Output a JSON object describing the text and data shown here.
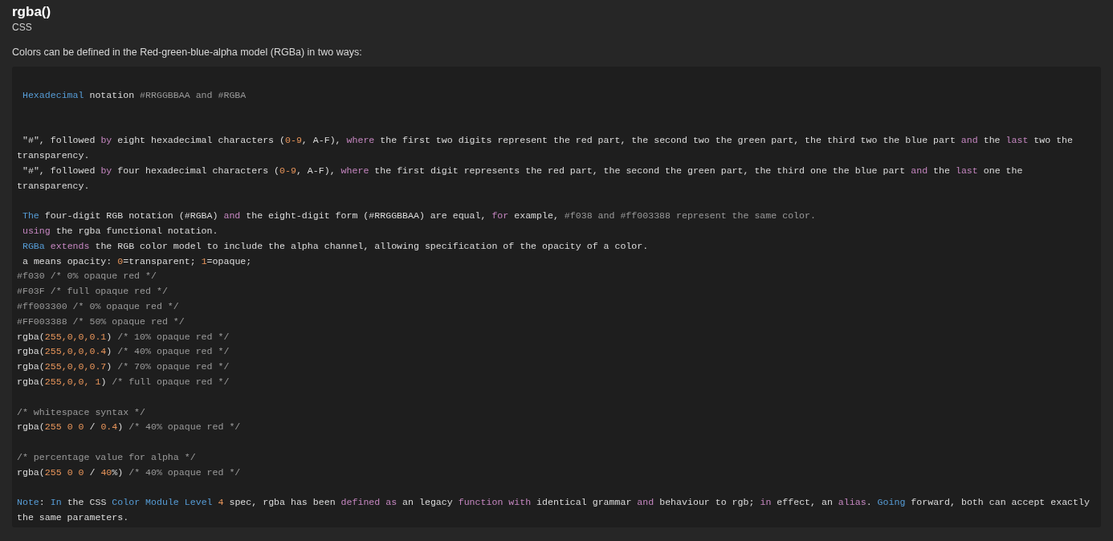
{
  "title": "rgba()",
  "subtitle": "CSS",
  "intro": "Colors can be defined in the Red-green-blue-alpha model (RGBa) in two ways:",
  "code_lines": [
    {
      "kind": "blank"
    },
    {
      "kind": "code",
      "indent": true,
      "tokens": [
        {
          "kind": "type",
          "s": "Hexadecimal"
        },
        {
          "kind": "plain",
          "s": " notation "
        },
        {
          "kind": "comment",
          "s": "#RRGGBBAA and #RGBA"
        }
      ]
    },
    {
      "kind": "blank"
    },
    {
      "kind": "blank"
    },
    {
      "kind": "code",
      "tokens": [
        {
          "kind": "plain",
          "s": " \"#\", followed "
        },
        {
          "kind": "keyword",
          "s": "by"
        },
        {
          "kind": "plain",
          "s": " eight hexadecimal characters ("
        },
        {
          "kind": "number",
          "s": "0-9"
        },
        {
          "kind": "plain",
          "s": ", A-F), "
        },
        {
          "kind": "keyword",
          "s": "where"
        },
        {
          "kind": "plain",
          "s": " the first two digits represent the red part, the second two the green part, the third two the blue part "
        },
        {
          "kind": "keyword",
          "s": "and"
        },
        {
          "kind": "plain",
          "s": " the "
        },
        {
          "kind": "keyword",
          "s": "last"
        },
        {
          "kind": "plain",
          "s": " two the transparency."
        }
      ]
    },
    {
      "kind": "code",
      "tokens": [
        {
          "kind": "plain",
          "s": " \"#\", followed "
        },
        {
          "kind": "keyword",
          "s": "by"
        },
        {
          "kind": "plain",
          "s": " four hexadecimal characters ("
        },
        {
          "kind": "number",
          "s": "0-9"
        },
        {
          "kind": "plain",
          "s": ", A-F), "
        },
        {
          "kind": "keyword",
          "s": "where"
        },
        {
          "kind": "plain",
          "s": " the first digit represents the red part, the second the green part, the third one the blue part "
        },
        {
          "kind": "keyword",
          "s": "and"
        },
        {
          "kind": "plain",
          "s": " the "
        },
        {
          "kind": "keyword",
          "s": "last"
        },
        {
          "kind": "plain",
          "s": " one the transparency."
        }
      ]
    },
    {
      "kind": "blank"
    },
    {
      "kind": "code",
      "indent": true,
      "tokens": [
        {
          "kind": "type",
          "s": "The"
        },
        {
          "kind": "plain",
          "s": " four-digit RGB notation (#RGBA) "
        },
        {
          "kind": "keyword",
          "s": "and"
        },
        {
          "kind": "plain",
          "s": " the eight-digit form (#RRGGBBAA) are equal, "
        },
        {
          "kind": "keyword",
          "s": "for"
        },
        {
          "kind": "plain",
          "s": " example, "
        },
        {
          "kind": "comment",
          "s": "#f038 and #ff003388 represent the same color."
        }
      ]
    },
    {
      "kind": "code",
      "indent": true,
      "tokens": [
        {
          "kind": "keyword",
          "s": "using"
        },
        {
          "kind": "plain",
          "s": " the rgba functional notation."
        }
      ]
    },
    {
      "kind": "code",
      "indent": true,
      "tokens": [
        {
          "kind": "type",
          "s": "RGBa"
        },
        {
          "kind": "keyword",
          "s": " extends"
        },
        {
          "kind": "plain",
          "s": " the RGB color model to include the alpha channel, allowing specification of the opacity of a color."
        }
      ]
    },
    {
      "kind": "code",
      "tokens": [
        {
          "kind": "plain",
          "s": " a means opacity: "
        },
        {
          "kind": "number",
          "s": "0"
        },
        {
          "kind": "plain",
          "s": "=transparent; "
        },
        {
          "kind": "number",
          "s": "1"
        },
        {
          "kind": "plain",
          "s": "=opaque;"
        }
      ]
    },
    {
      "kind": "code",
      "tokens": [
        {
          "kind": "comment",
          "s": "#f030 /* 0% opaque red */"
        }
      ]
    },
    {
      "kind": "code",
      "tokens": [
        {
          "kind": "comment",
          "s": "#F03F /* full opaque red */"
        }
      ]
    },
    {
      "kind": "code",
      "tokens": [
        {
          "kind": "comment",
          "s": "#ff003300 /* 0% opaque red */"
        }
      ]
    },
    {
      "kind": "code",
      "tokens": [
        {
          "kind": "comment",
          "s": "#FF003388 /* 50% opaque red */"
        }
      ]
    },
    {
      "kind": "code",
      "tokens": [
        {
          "kind": "plain",
          "s": "rgba("
        },
        {
          "kind": "number",
          "s": "255,0,0,0.1"
        },
        {
          "kind": "plain",
          "s": ") "
        },
        {
          "kind": "comment",
          "s": "/* 10% opaque red */"
        }
      ]
    },
    {
      "kind": "code",
      "tokens": [
        {
          "kind": "plain",
          "s": "rgba("
        },
        {
          "kind": "number",
          "s": "255,0,0,0.4"
        },
        {
          "kind": "plain",
          "s": ") "
        },
        {
          "kind": "comment",
          "s": "/* 40% opaque red */"
        }
      ]
    },
    {
      "kind": "code",
      "tokens": [
        {
          "kind": "plain",
          "s": "rgba("
        },
        {
          "kind": "number",
          "s": "255,0,0,0.7"
        },
        {
          "kind": "plain",
          "s": ") "
        },
        {
          "kind": "comment",
          "s": "/* 70% opaque red */"
        }
      ]
    },
    {
      "kind": "code",
      "tokens": [
        {
          "kind": "plain",
          "s": "rgba("
        },
        {
          "kind": "number",
          "s": "255,0,0, 1"
        },
        {
          "kind": "plain",
          "s": ") "
        },
        {
          "kind": "comment",
          "s": "/* full opaque red */"
        }
      ]
    },
    {
      "kind": "blank"
    },
    {
      "kind": "code",
      "tokens": [
        {
          "kind": "comment",
          "s": "/* whitespace syntax */"
        }
      ]
    },
    {
      "kind": "code",
      "tokens": [
        {
          "kind": "plain",
          "s": "rgba("
        },
        {
          "kind": "number",
          "s": "255 0 0"
        },
        {
          "kind": "plain",
          "s": " / "
        },
        {
          "kind": "number",
          "s": "0.4"
        },
        {
          "kind": "plain",
          "s": ") "
        },
        {
          "kind": "comment",
          "s": "/* 40% opaque red */"
        }
      ]
    },
    {
      "kind": "blank"
    },
    {
      "kind": "code",
      "tokens": [
        {
          "kind": "comment",
          "s": "/* percentage value for alpha */"
        }
      ]
    },
    {
      "kind": "code",
      "tokens": [
        {
          "kind": "plain",
          "s": "rgba("
        },
        {
          "kind": "number",
          "s": "255 0 0"
        },
        {
          "kind": "plain",
          "s": " / "
        },
        {
          "kind": "number",
          "s": "40"
        },
        {
          "kind": "plain",
          "s": "%) "
        },
        {
          "kind": "comment",
          "s": "/* 40% opaque red */"
        }
      ]
    },
    {
      "kind": "blank"
    },
    {
      "kind": "code",
      "tokens": [
        {
          "kind": "type",
          "s": "Note"
        },
        {
          "kind": "plain",
          "s": ": "
        },
        {
          "kind": "type",
          "s": "In"
        },
        {
          "kind": "plain",
          "s": " the CSS "
        },
        {
          "kind": "type",
          "s": "Color Module Level"
        },
        {
          "kind": "number",
          "s": " 4"
        },
        {
          "kind": "plain",
          "s": " spec, rgba has been "
        },
        {
          "kind": "keyword",
          "s": "defined as"
        },
        {
          "kind": "plain",
          "s": " an legacy "
        },
        {
          "kind": "keyword",
          "s": "function with"
        },
        {
          "kind": "plain",
          "s": " identical grammar "
        },
        {
          "kind": "keyword",
          "s": "and"
        },
        {
          "kind": "plain",
          "s": " behaviour to rgb; "
        },
        {
          "kind": "keyword",
          "s": "in"
        },
        {
          "kind": "plain",
          "s": " effect, an "
        },
        {
          "kind": "keyword",
          "s": "alias"
        },
        {
          "kind": "plain",
          "s": ". "
        },
        {
          "kind": "type",
          "s": "Going"
        },
        {
          "kind": "plain",
          "s": " forward, both can accept exactly the same parameters."
        }
      ]
    }
  ]
}
